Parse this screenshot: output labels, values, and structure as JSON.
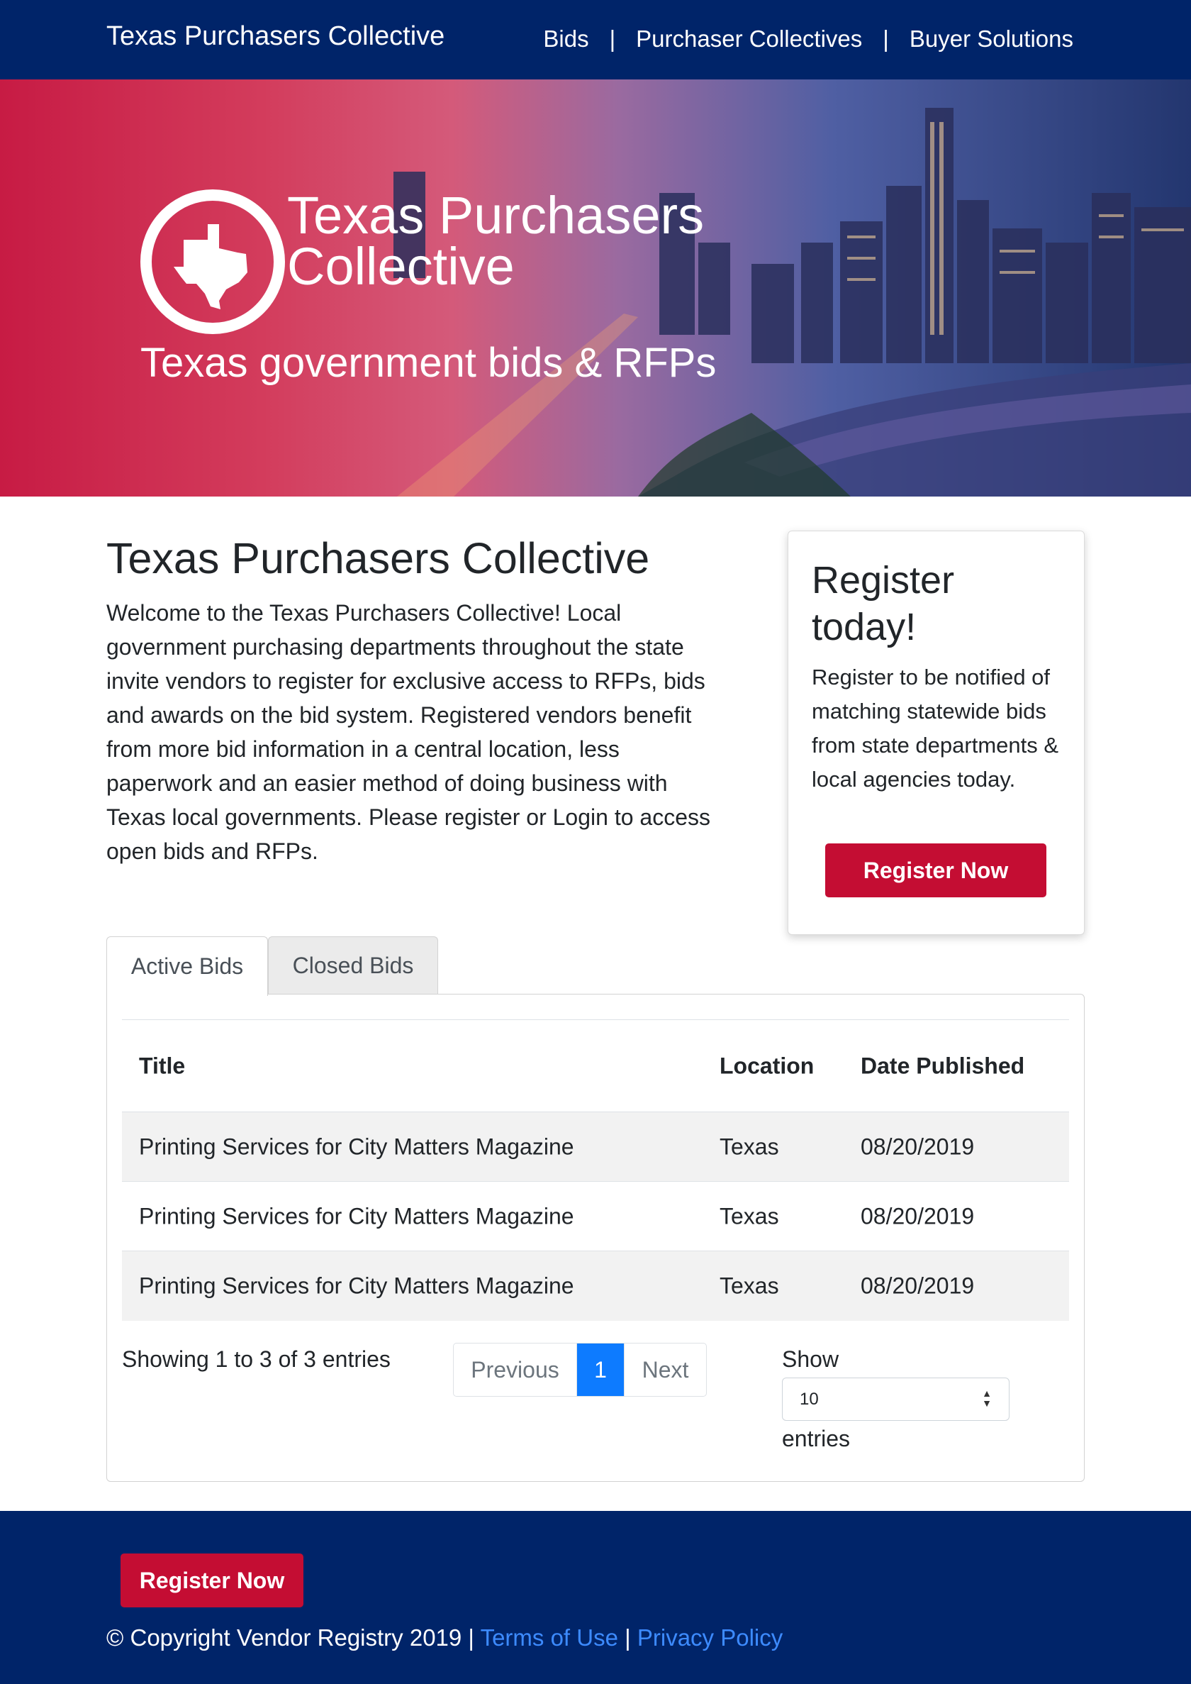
{
  "navbar": {
    "brand": "Texas Purchasers Collective",
    "links": [
      "Bids",
      "Purchaser Collectives",
      "Buyer Solutions"
    ],
    "separator": "|"
  },
  "hero": {
    "title_line1": "Texas Purchasers",
    "title_line2": "Collective",
    "subtitle": "Texas government bids & RFPs"
  },
  "intro": {
    "heading": "Texas Purchasers Collective",
    "body": "Welcome to the Texas Purchasers Collective! Local government purchasing departments throughout the state invite vendors to register for exclusive access to RFPs, bids and awards on the bid system. Registered vendors benefit from more bid information in a central location, less paperwork and an easier method of doing business with Texas local governments. Please register or Login to access open bids and RFPs."
  },
  "register_card": {
    "heading": "Register today!",
    "body": "Register to be notified of matching statewide bids from state departments & local agencies today.",
    "button": "Register Now"
  },
  "tabs": [
    "Active Bids",
    "Closed Bids"
  ],
  "table": {
    "headers": [
      "Title",
      "Location",
      "Date Published"
    ],
    "rows": [
      [
        "Printing Services for City Matters Magazine",
        "Texas",
        "08/20/2019"
      ],
      [
        "Printing Services for City Matters Magazine",
        "Texas",
        "08/20/2019"
      ],
      [
        "Printing Services for City Matters Magazine",
        "Texas",
        "08/20/2019"
      ]
    ]
  },
  "pagination": {
    "info": "Showing 1 to 3 of 3 entries",
    "previous": "Previous",
    "current": "1",
    "next": "Next"
  },
  "length_menu": {
    "show": "Show",
    "value": "10",
    "entries": "entries"
  },
  "footer": {
    "button": "Register Now",
    "copyright": "© Copyright Vendor Registry 2019 |",
    "terms": "Terms of Use",
    "divider": "|",
    "privacy": "Privacy Policy"
  },
  "colors": {
    "navy": "#002469",
    "brand_red": "#c40d33",
    "link_blue": "#3d8bff",
    "page_active": "#0d7bff"
  }
}
